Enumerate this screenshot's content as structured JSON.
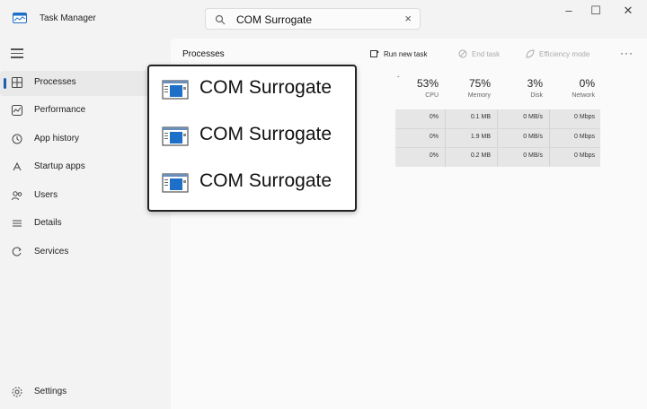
{
  "window": {
    "title": "Task Manager",
    "search_value": "COM Surrogate",
    "controls": {
      "minimize": "–",
      "maximize": "☐",
      "close": "✕"
    }
  },
  "sidebar": {
    "items": [
      {
        "label": "Processes",
        "icon": "processes-icon",
        "active": true
      },
      {
        "label": "Performance",
        "icon": "performance-icon"
      },
      {
        "label": "App history",
        "icon": "app-history-icon"
      },
      {
        "label": "Startup apps",
        "icon": "startup-apps-icon"
      },
      {
        "label": "Users",
        "icon": "users-icon"
      },
      {
        "label": "Details",
        "icon": "details-icon"
      },
      {
        "label": "Services",
        "icon": "services-icon"
      }
    ],
    "settings_label": "Settings"
  },
  "toolbar": {
    "page_title": "Processes",
    "run_new_task": "Run new task",
    "end_task": "End task",
    "efficiency_mode": "Efficiency mode",
    "more": "···"
  },
  "columns": [
    {
      "pct": "53%",
      "label": "CPU"
    },
    {
      "pct": "75%",
      "label": "Memory"
    },
    {
      "pct": "3%",
      "label": "Disk"
    },
    {
      "pct": "0%",
      "label": "Network"
    }
  ],
  "rows": [
    {
      "cpu": "0%",
      "memory": "0.1 MB",
      "disk": "0 MB/s",
      "network": "0 Mbps"
    },
    {
      "cpu": "0%",
      "memory": "1.9 MB",
      "disk": "0 MB/s",
      "network": "0 Mbps"
    },
    {
      "cpu": "0%",
      "memory": "0.2 MB",
      "disk": "0 MB/s",
      "network": "0 Mbps"
    }
  ],
  "callout": {
    "items": [
      {
        "name": "COM Surrogate"
      },
      {
        "name": "COM Surrogate"
      },
      {
        "name": "COM Surrogate"
      }
    ]
  },
  "colors": {
    "accent": "#1a5fb4",
    "process_icon": "#1e6fc7"
  }
}
